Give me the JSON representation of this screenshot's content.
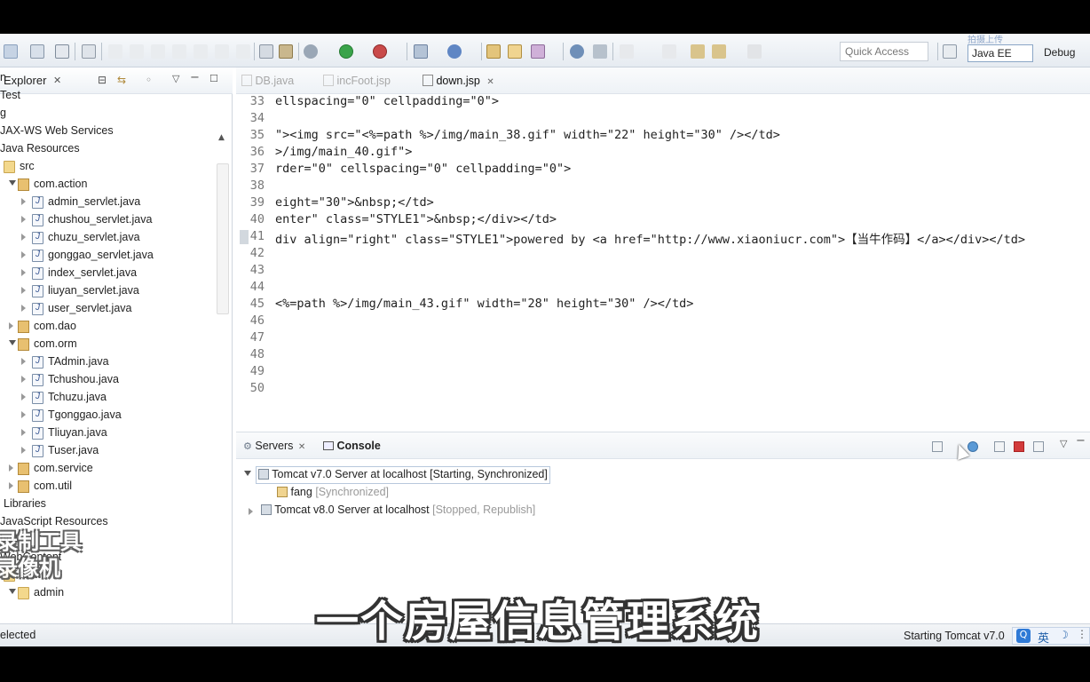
{
  "toolbar": {
    "quick_access_placeholder": "Quick Access",
    "perspectives": [
      "Java EE",
      "Debug"
    ],
    "ribbon_text": "拍摄上传"
  },
  "explorer": {
    "title": "Explorer",
    "rows": [
      {
        "label": "n",
        "indent": 0,
        "icon": "none",
        "expander": "none"
      },
      {
        "label": "Test",
        "indent": 0,
        "icon": "none",
        "expander": "none"
      },
      {
        "label": "g",
        "indent": 0,
        "icon": "none",
        "expander": "none"
      },
      {
        "label": "JAX-WS Web Services",
        "indent": 0,
        "icon": "none",
        "expander": "none"
      },
      {
        "label": "Java Resources",
        "indent": 0,
        "icon": "none",
        "expander": "none"
      },
      {
        "label": "src",
        "indent": 1,
        "icon": "folder",
        "expander": "none"
      },
      {
        "label": "com.action",
        "indent": 2,
        "icon": "pkg",
        "expander": "open"
      },
      {
        "label": "admin_servlet.java",
        "indent": 3,
        "icon": "java",
        "expander": "closed"
      },
      {
        "label": "chushou_servlet.java",
        "indent": 3,
        "icon": "java",
        "expander": "closed"
      },
      {
        "label": "chuzu_servlet.java",
        "indent": 3,
        "icon": "java",
        "expander": "closed"
      },
      {
        "label": "gonggao_servlet.java",
        "indent": 3,
        "icon": "java",
        "expander": "closed"
      },
      {
        "label": "index_servlet.java",
        "indent": 3,
        "icon": "java",
        "expander": "closed"
      },
      {
        "label": "liuyan_servlet.java",
        "indent": 3,
        "icon": "java",
        "expander": "closed"
      },
      {
        "label": "user_servlet.java",
        "indent": 3,
        "icon": "java",
        "expander": "closed"
      },
      {
        "label": "com.dao",
        "indent": 2,
        "icon": "pkg",
        "expander": "closed"
      },
      {
        "label": "com.orm",
        "indent": 2,
        "icon": "pkg",
        "expander": "open"
      },
      {
        "label": "TAdmin.java",
        "indent": 3,
        "icon": "java",
        "expander": "closed"
      },
      {
        "label": "Tchushou.java",
        "indent": 3,
        "icon": "java",
        "expander": "closed"
      },
      {
        "label": "Tchuzu.java",
        "indent": 3,
        "icon": "java",
        "expander": "closed"
      },
      {
        "label": "Tgonggao.java",
        "indent": 3,
        "icon": "java",
        "expander": "closed"
      },
      {
        "label": "Tliuyan.java",
        "indent": 3,
        "icon": "java",
        "expander": "closed"
      },
      {
        "label": "Tuser.java",
        "indent": 3,
        "icon": "java",
        "expander": "closed"
      },
      {
        "label": "com.service",
        "indent": 2,
        "icon": "pkg",
        "expander": "closed"
      },
      {
        "label": "com.util",
        "indent": 2,
        "icon": "pkg",
        "expander": "closed"
      },
      {
        "label": "Libraries",
        "indent": 1,
        "icon": "none",
        "expander": "none"
      },
      {
        "label": "JavaScript Resources",
        "indent": 0,
        "icon": "none",
        "expander": "none"
      },
      {
        "label": "build",
        "indent": 0,
        "icon": "none",
        "expander": "none"
      },
      {
        "label": "WebContent",
        "indent": 0,
        "icon": "none",
        "expander": "none"
      },
      {
        "label": "admin",
        "indent": 1,
        "icon": "folder",
        "expander": "none"
      },
      {
        "label": "admin",
        "indent": 2,
        "icon": "folder",
        "expander": "open"
      }
    ],
    "status": "elected"
  },
  "editor": {
    "tabs": [
      {
        "label": "DB.java",
        "active": false
      },
      {
        "label": "incFoot.jsp",
        "active": false
      },
      {
        "label": "down.jsp",
        "active": true
      }
    ],
    "lines": [
      {
        "num": "33",
        "text": "ellspacing=\"0\" cellpadding=\"0\">"
      },
      {
        "num": "34",
        "text": ""
      },
      {
        "num": "35",
        "text": "\"><img src=\"<%=path %>/img/main_38.gif\" width=\"22\" height=\"30\" /></td>"
      },
      {
        "num": "36",
        "text": ">/img/main_40.gif\">"
      },
      {
        "num": "37",
        "text": "rder=\"0\" cellspacing=\"0\" cellpadding=\"0\">"
      },
      {
        "num": "38",
        "text": ""
      },
      {
        "num": "39",
        "text": "eight=\"30\">&nbsp;</td>"
      },
      {
        "num": "40",
        "text": "enter\" class=\"STYLE1\">&nbsp;</div></td>"
      },
      {
        "num": "41",
        "text": "div align=\"right\" class=\"STYLE1\">powered by <a href=\"http://www.xiaoniucr.com\">【当牛作码】</a></div></td>"
      },
      {
        "num": "42",
        "text": ""
      },
      {
        "num": "43",
        "text": ""
      },
      {
        "num": "44",
        "text": ""
      },
      {
        "num": "45",
        "text": "<%=path %>/img/main_43.gif\" width=\"28\" height=\"30\" /></td>"
      },
      {
        "num": "46",
        "text": ""
      },
      {
        "num": "47",
        "text": ""
      },
      {
        "num": "48",
        "text": ""
      },
      {
        "num": "49",
        "text": ""
      },
      {
        "num": "50",
        "text": ""
      }
    ]
  },
  "servers_panel": {
    "tabs": [
      {
        "label": "Servers",
        "active": false
      },
      {
        "label": "Console",
        "active": true
      }
    ],
    "rows": [
      {
        "name": "Tomcat v7.0 Server at localhost",
        "state": "[Starting, Synchronized]",
        "selected": true
      },
      {
        "name": "fang",
        "state": "[Synchronized]",
        "selected": false
      },
      {
        "name": "Tomcat v8.0 Server at localhost",
        "state": "[Stopped, Republish]",
        "selected": false
      }
    ]
  },
  "statusbar": {
    "right_text": "Starting Tomcat v7.0",
    "ime_label": "英"
  },
  "overlay": {
    "subtitle": "一个房屋信息管理系统",
    "watermark_line1": "录制工具",
    "watermark_line2": "录像机"
  },
  "colors": {
    "accent": "#3c5a96",
    "string": "#2a00ff",
    "jsp_tag": "#bf5f3f",
    "stop_red": "#d23b3b"
  }
}
